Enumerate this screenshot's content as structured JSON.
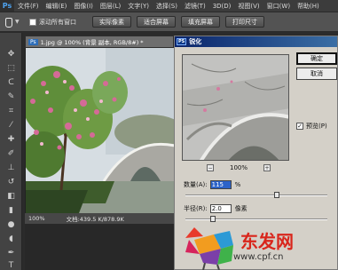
{
  "app": {
    "logo": "Ps"
  },
  "menu": [
    "文件(F)",
    "编辑(E)",
    "图像(I)",
    "图层(L)",
    "文字(Y)",
    "选择(S)",
    "滤镜(T)",
    "3D(D)",
    "视图(V)",
    "窗口(W)",
    "帮助(H)"
  ],
  "options": {
    "scroll_all_label": "滚动所有窗口",
    "buttons": [
      "实际像素",
      "适合屏幕",
      "填充屏幕",
      "打印尺寸"
    ]
  },
  "document": {
    "tab_title": "1.jpg @ 100% (背景 副本, RGB/8#) *",
    "zoom": "100%",
    "doc_info": "文档:439.5 K/878.9K"
  },
  "dialog": {
    "title": "锐化",
    "ok": "确定",
    "cancel": "取消",
    "preview_label": "预览(P)",
    "preview_checked": "✓",
    "preview_zoom": "100%",
    "zoom_out": "−",
    "zoom_in": "+",
    "amount_label": "数量(A):",
    "amount_value": "115",
    "amount_unit": "%",
    "radius_label": "半径(R):",
    "radius_value": "2.0",
    "radius_unit": "像素"
  },
  "watermark": {
    "text": "东发网",
    "url": "www.cpf.cn"
  },
  "colors": {
    "accent": "#0a246a",
    "watermark_red": "#d9261c"
  }
}
